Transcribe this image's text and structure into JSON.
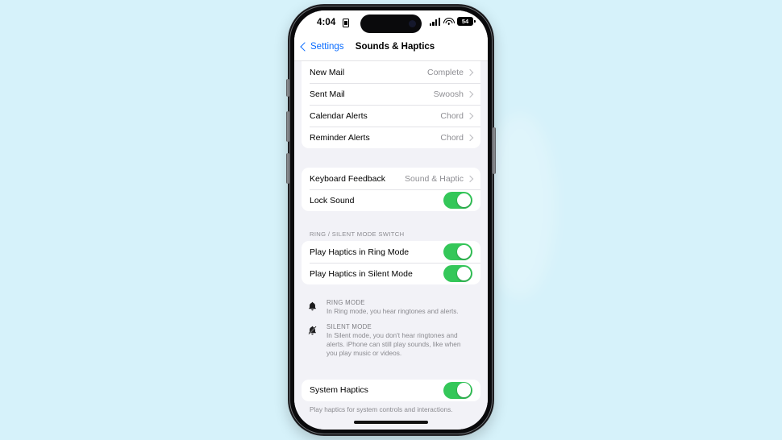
{
  "background": {
    "color": "#d6f2fa"
  },
  "device": {
    "frame_color": "#0a0a0c",
    "screen_bg": "#f2f2f7",
    "accent_blue": "#0a6cff",
    "toggle_green": "#34c759"
  },
  "status_bar": {
    "time": "4:04",
    "lock_icon": "lock-portrait-orientation-icon",
    "cellular_icon": "cellular-signal-icon",
    "wifi_icon": "wifi-icon",
    "battery_level": "54",
    "battery_icon": "battery-icon"
  },
  "nav_bar": {
    "back_icon": "chevron-left-icon",
    "back_label": "Settings",
    "title": "Sounds & Haptics"
  },
  "sections": {
    "alert_tones": {
      "rows": [
        {
          "label": "New Mail",
          "value": "Complete",
          "accessory": "chevron-right-icon"
        },
        {
          "label": "Sent Mail",
          "value": "Swoosh",
          "accessory": "chevron-right-icon"
        },
        {
          "label": "Calendar Alerts",
          "value": "Chord",
          "accessory": "chevron-right-icon"
        },
        {
          "label": "Reminder Alerts",
          "value": "Chord",
          "accessory": "chevron-right-icon"
        }
      ]
    },
    "keyboard_lock": {
      "rows": [
        {
          "label": "Keyboard Feedback",
          "value": "Sound & Haptic",
          "accessory": "chevron-right-icon"
        },
        {
          "label": "Lock Sound",
          "toggle": true,
          "toggle_on": true
        }
      ]
    },
    "ring_silent": {
      "header": "RING / SILENT MODE SWITCH",
      "rows": [
        {
          "label": "Play Haptics in Ring Mode",
          "toggle": true,
          "toggle_on": true
        },
        {
          "label": "Play Haptics in Silent Mode",
          "toggle": true,
          "toggle_on": true
        }
      ],
      "info": [
        {
          "icon": "bell-icon",
          "title": "RING MODE",
          "desc": "In Ring mode, you hear ringtones and alerts."
        },
        {
          "icon": "bell-slash-icon",
          "title": "SILENT MODE",
          "desc": "In Silent mode, you don't hear ringtones and alerts. iPhone can still play sounds, like when you play music or videos."
        }
      ]
    },
    "system_haptics": {
      "rows": [
        {
          "label": "System Haptics",
          "toggle": true,
          "toggle_on": true
        }
      ],
      "footer": "Play haptics for system controls and interactions."
    }
  },
  "home_indicator": "home-indicator"
}
